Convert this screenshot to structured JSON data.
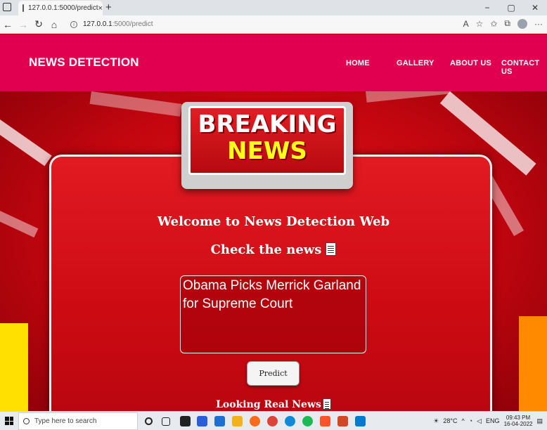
{
  "browser": {
    "tab_title": "127.0.0.1:5000/predict",
    "tab_close": "×",
    "new_tab": "+",
    "url_host": "127.0.0.1",
    "url_path": ":5000/predict",
    "win_min": "−",
    "win_max": "▢",
    "win_close": "✕"
  },
  "header": {
    "brand": "NEWS DETECTION",
    "nav": [
      "HOME",
      "GALLERY",
      "ABOUT US",
      "CONTACT US"
    ]
  },
  "hero": {
    "sign_line1": "BREAKING",
    "sign_line2": "NEWS",
    "welcome": "Welcome to News Detection Web",
    "check": "Check the news",
    "input_value": "Obama Picks Merrick Garland for Supreme Court",
    "predict_label": "Predict",
    "looking": "Looking Real News"
  },
  "taskbar": {
    "search_placeholder": "Type here to search",
    "weather": "28°C",
    "lang": "ENG",
    "time": "09:43 PM",
    "date": "16-04-2022"
  },
  "colors": {
    "header_bg": "#e0004f",
    "panel_red": "#d90f18",
    "sign_yellow": "#ffff1a"
  }
}
